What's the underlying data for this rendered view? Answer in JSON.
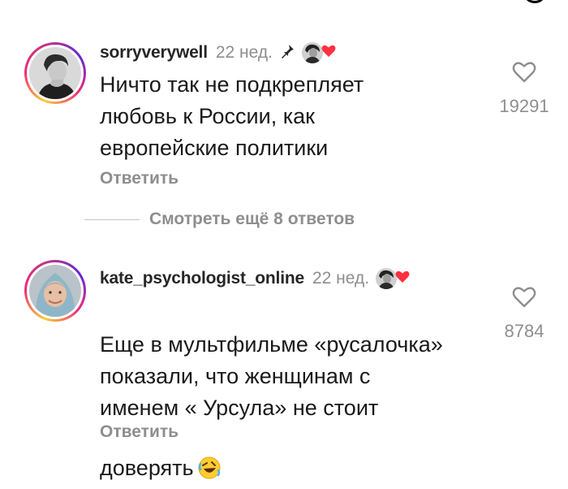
{
  "comments": [
    {
      "username": "sorryverywell",
      "time": "22 нед.",
      "text": "Ничто так не подкрепляет\nлюбовь к России, как\nевропейские политики",
      "reply_label": "Ответить",
      "likes": "19291"
    },
    {
      "username": "kate_psychologist_online",
      "time": "22 нед.",
      "text": "Еще в мультфильме «русалочка»\nпоказали, что женщинам с\nименем « Урсула» не стоит\nдоверять",
      "reply_label": "Ответить",
      "likes": "8784"
    }
  ],
  "view_more_label": "Смотреть ещё 8 ответов",
  "icons": {
    "pin": "pin-icon",
    "heart": "heart-outline-icon",
    "creator_heart": "red-heart-icon",
    "emoji": "rolling-on-floor-laughing-emoji"
  },
  "colors": {
    "creator_heart": "#ff3040",
    "muted_text": "#8e8e8e",
    "story_ring": [
      "#f9ce34",
      "#ee2a7b",
      "#6228d7"
    ]
  }
}
